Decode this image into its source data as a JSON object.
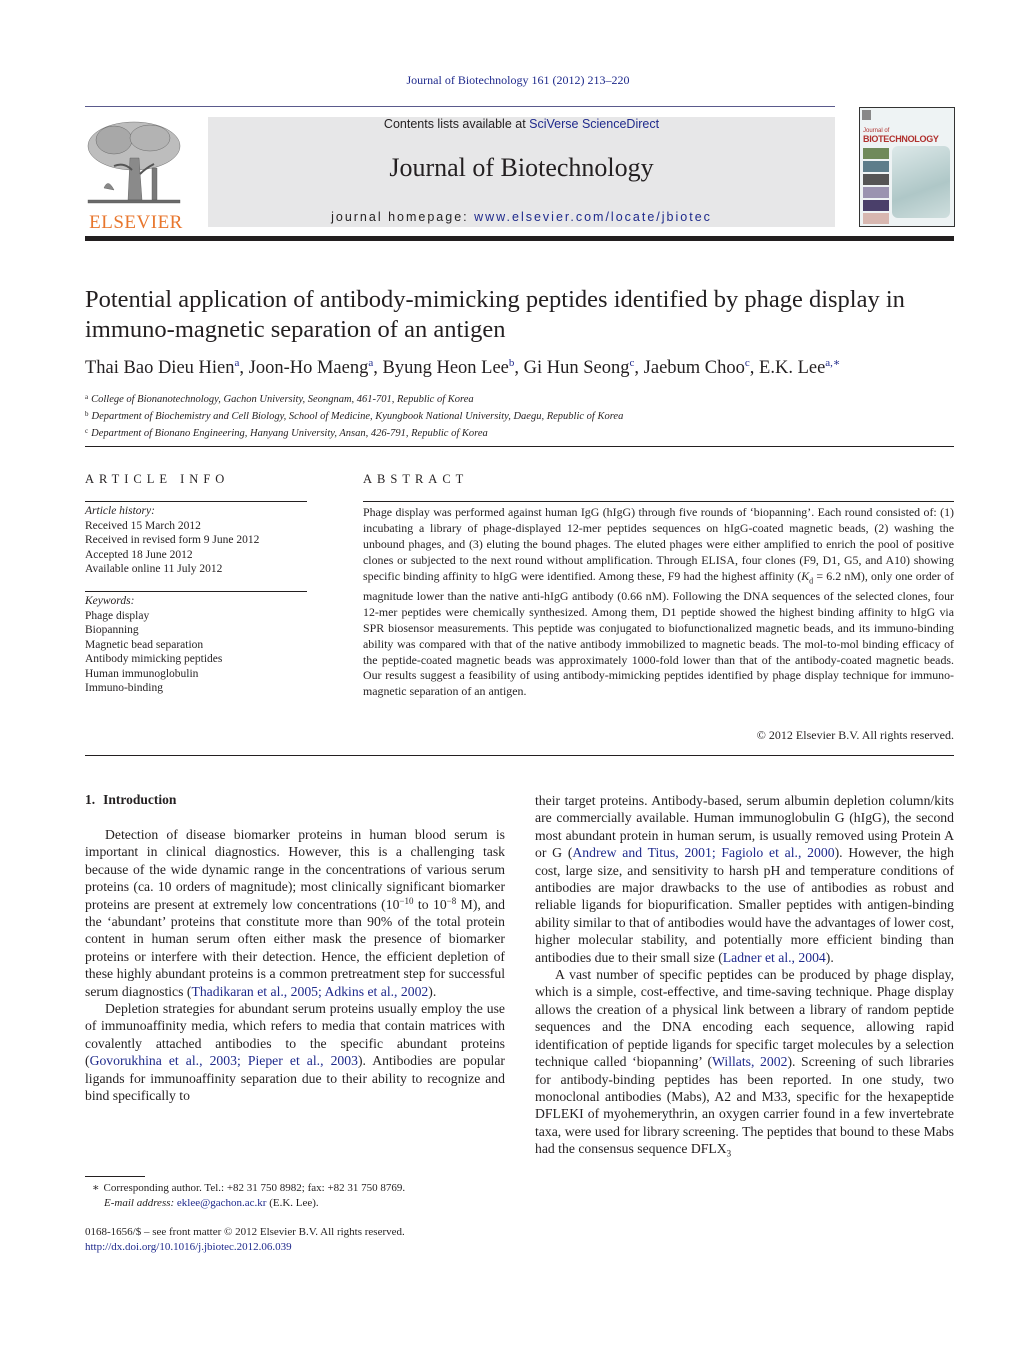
{
  "header": {
    "citation": "Journal of Biotechnology 161 (2012) 213–220",
    "publisher_wordmark": "ELSEVIER",
    "contents_prefix": "Contents lists available at ",
    "contents_link": "SciVerse ScienceDirect",
    "journal_name": "Journal of Biotechnology",
    "homepage_prefix": "journal homepage: ",
    "homepage_link": "www.elsevier.com/locate/jbiotec",
    "cover": {
      "line1": "Journal of",
      "line2": "BIOTECHNOLOGY"
    }
  },
  "article": {
    "title": "Potential application of antibody-mimicking peptides identified by phage display in immuno-magnetic separation of an antigen",
    "authors": [
      {
        "name": "Thai Bao Dieu Hien",
        "aff": "a"
      },
      {
        "name": "Joon-Ho Maeng",
        "aff": "a"
      },
      {
        "name": "Byung Heon Lee",
        "aff": "b"
      },
      {
        "name": "Gi Hun Seong",
        "aff": "c"
      },
      {
        "name": "Jaebum Choo",
        "aff": "c"
      },
      {
        "name": "E.K. Lee",
        "aff": "a,∗"
      }
    ],
    "affiliations": [
      {
        "mark": "a",
        "text": "College of Bionanotechnology, Gachon University, Seongnam, 461-701, Republic of Korea"
      },
      {
        "mark": "b",
        "text": "Department of Biochemistry and Cell Biology, School of Medicine, Kyungbook National University, Daegu, Republic of Korea"
      },
      {
        "mark": "c",
        "text": "Department of Bionano Engineering, Hanyang University, Ansan, 426-791, Republic of Korea"
      }
    ]
  },
  "article_info": {
    "label": "ARTICLE INFO",
    "history_heading": "Article history:",
    "history": [
      "Received 15 March 2012",
      "Received in revised form 9 June 2012",
      "Accepted 18 June 2012",
      "Available online 11 July 2012"
    ],
    "keywords_heading": "Keywords:",
    "keywords": [
      "Phage display",
      "Biopanning",
      "Magnetic bead separation",
      "Antibody mimicking peptides",
      "Human immunoglobulin",
      "Immuno-binding"
    ]
  },
  "abstract": {
    "label": "ABSTRACT",
    "part1": "Phage display was performed against human IgG (hIgG) through five rounds of ‘biopanning’. Each round consisted of: (1) incubating a library of phage-displayed 12-mer peptides sequences on hIgG-coated magnetic beads, (2) washing the unbound phages, and (3) eluting the bound phages. The eluted phages were either amplified to enrich the pool of positive clones or subjected to the next round without amplification. Through ELISA, four clones (F9, D1, G5, and A10) showing specific binding affinity to hIgG were identified. Among these, F9 had the highest affinity (",
    "kd_symbol": "K",
    "kd_sub": "d",
    "part2": " = 6.2 nM), only one order of magnitude lower than the native anti-hIgG antibody (0.66 nM). Following the DNA sequences of the selected clones, four 12-mer peptides were chemically synthesized. Among them, D1 peptide showed the highest binding affinity to hIgG via SPR biosensor measurements. This peptide was conjugated to biofunctionalized magnetic beads, and its immuno-binding ability was compared with that of the native antibody immobilized to magnetic beads. The mol-to-mol binding efficacy of the peptide-coated magnetic beads was approximately 1000-fold lower than that of the antibody-coated magnetic beads. Our results suggest a feasibility of using antibody-mimicking peptides identified by phage display technique for immuno-magnetic separation of an antigen.",
    "copyright": "© 2012 Elsevier B.V. All rights reserved."
  },
  "introduction": {
    "number": "1.",
    "heading": "Introduction",
    "p1": {
      "a": "Detection of disease biomarker proteins in human blood serum is important in clinical diagnostics. However, this is a challenging task because of the wide dynamic range in the concentrations of various serum proteins (ca. 10 orders of magnitude); most clinically significant biomarker proteins are present at extremely low concentrations (10",
      "exp1": "−10",
      "b": " to 10",
      "exp2": "−8",
      "c": " M), and the ‘abundant’ proteins that constitute more than 90% of the total protein content in human serum often either mask the presence of biomarker proteins or interfere with their detection. Hence, the efficient depletion of these highly abundant proteins is a common pretreatment step for successful serum diagnostics (",
      "ref1": "Thadikaran et al., 2005; Adkins et al., 2002",
      "d": ")."
    },
    "p2": {
      "a": "Depletion strategies for abundant serum proteins usually employ the use of immunoaffinity media, which refers to media that contain matrices with covalently attached antibodies to the specific abundant proteins (",
      "ref1": "Govorukhina et al., 2003; Pieper et al., 2003",
      "b": "). Antibodies are popular ligands for immunoaffinity separation due to their ability to recognize and bind specifically to their target proteins. Antibody-based, serum albumin depletion column/kits are commercially available. Human immunoglobulin G (hIgG), the second most abundant protein in human serum, is usually removed using Protein A or G (",
      "ref2": "Andrew and Titus, 2001; Fagiolo et al., 2000",
      "c": "). However, the high cost, large size, and sensitivity to harsh pH and temperature conditions of antibodies are major drawbacks to the use of antibodies as robust and reliable ligands for biopurification. Smaller peptides with antigen-binding ability similar to that of antibodies would have the advantages of lower cost, higher molecular stability, and potentially more efficient binding than antibodies due to their small size (",
      "ref3": "Ladner et al., 2004",
      "d": ")."
    },
    "p3": {
      "a": "A vast number of specific peptides can be produced by phage display, which is a simple, cost-effective, and time-saving technique. Phage display allows the creation of a physical link between a library of random peptide sequences and the DNA encoding each sequence, allowing rapid identification of peptide ligands for specific target molecules by a selection technique called ‘biopanning’ (",
      "ref1": "Willats, 2002",
      "b": "). Screening of such libraries for antibody-binding peptides has been reported. In one study, two monoclonal antibodies (Mabs), A2 and M33, specific for the hexapeptide DFLEKI of myohemerythrin, an oxygen carrier found in a few invertebrate taxa, were used for library screening. The peptides that bound to these Mabs had the consensus sequence DFLX",
      "sub": "3"
    }
  },
  "footnote": {
    "star": "∗",
    "corresponding": "Corresponding author. Tel.: +82 31 750 8982; fax: +82 31 750 8769.",
    "email_label": "E-mail address:",
    "email": "eklee@gachon.ac.kr",
    "email_suffix": " (E.K. Lee)."
  },
  "front_matter": {
    "issn_line": "0168-1656/$ – see front matter © 2012 Elsevier B.V. All rights reserved.",
    "doi": "http://dx.doi.org/10.1016/j.jbiotec.2012.06.039"
  },
  "colors": {
    "link": "#1f2a8c",
    "elsevier_orange": "#e8762d",
    "masthead_gray": "#e7e7e8",
    "text": "#231f20"
  }
}
